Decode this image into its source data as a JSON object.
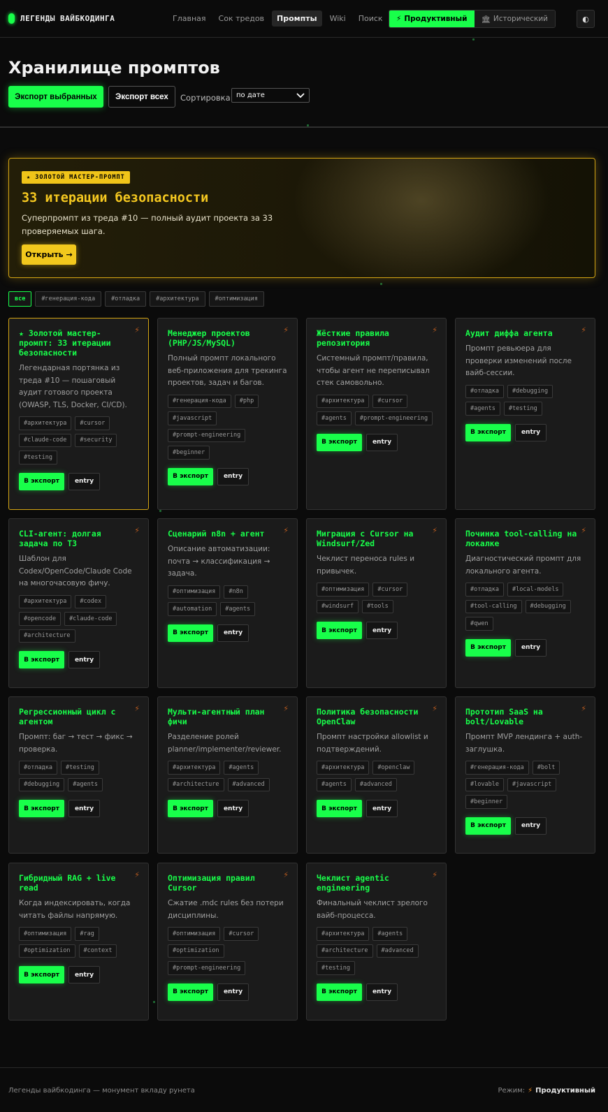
{
  "nav": {
    "logo": "ЛЕГЕНДЫ ВАЙБКОДИНГА",
    "items": [
      "Главная",
      "Сок тредов",
      "Промпты",
      "Wiki",
      "Поиск"
    ],
    "active_index": 2,
    "modes": [
      {
        "icon": "⚡",
        "label": "Продуктивный"
      },
      {
        "icon": "🏛",
        "label": "Исторический"
      }
    ],
    "theme_icon": "◐"
  },
  "header": {
    "title": "Хранилище промптов",
    "export_selected": "Экспорт выбранных",
    "export_all": "Экспорт всех",
    "sort_label": "Сортировка:",
    "sort_value": "по дате"
  },
  "hero": {
    "badge": "★ ЗОЛОТОЙ МАСТЕР-ПРОМПТ",
    "title": "33 итерации безопасности",
    "desc": "Суперпромпт из треда #10 — полный аудит проекта за 33 проверяемых шага.",
    "button": "Открыть →"
  },
  "filters": [
    "все",
    "#генерация-кода",
    "#отладка",
    "#архитектура",
    "#оптимизация"
  ],
  "card_buttons": {
    "export": "В экспорт",
    "entry": "entry"
  },
  "cards": [
    {
      "title": "★ Золотой мастер-промпт: 33 итерации безопасности",
      "desc": "Легендарная портянка из треда #10 — пошаговый аудит готового проекта (OWASP, TLS, Docker, CI/CD).",
      "tags": [
        "#архитектура",
        "#cursor",
        "#claude-code",
        "#security",
        "#testing"
      ],
      "gold": true
    },
    {
      "title": "Менеджер проектов (PHP/JS/MySQL)",
      "desc": "Полный промпт локального веб-приложения для трекинга проектов, задач и багов.",
      "tags": [
        "#генерация-кода",
        "#php",
        "#javascript",
        "#prompt-engineering",
        "#beginner"
      ]
    },
    {
      "title": "Жёсткие правила репозитория",
      "desc": "Системный промпт/правила, чтобы агент не переписывал стек самовольно.",
      "tags": [
        "#архитектура",
        "#cursor",
        "#agents",
        "#prompt-engineering"
      ]
    },
    {
      "title": "Аудит диффа агента",
      "desc": "Промпт ревьюера для проверки изменений после вайб-сессии.",
      "tags": [
        "#отладка",
        "#debugging",
        "#agents",
        "#testing"
      ]
    },
    {
      "title": "CLI-агент: долгая задача по ТЗ",
      "desc": "Шаблон для Codex/OpenCode/Claude Code на многочасовую фичу.",
      "tags": [
        "#архитектура",
        "#codex",
        "#opencode",
        "#claude-code",
        "#architecture"
      ]
    },
    {
      "title": "Сценарий n8n + агент",
      "desc": "Описание автоматизации: почта → классификация → задача.",
      "tags": [
        "#оптимизация",
        "#n8n",
        "#automation",
        "#agents"
      ]
    },
    {
      "title": "Миграция с Cursor на Windsurf/Zed",
      "desc": "Чеклист переноса rules и привычек.",
      "tags": [
        "#оптимизация",
        "#cursor",
        "#windsurf",
        "#tools"
      ]
    },
    {
      "title": "Починка tool-calling на локалке",
      "desc": "Диагностический промпт для локального агента.",
      "tags": [
        "#отладка",
        "#local-models",
        "#tool-calling",
        "#debugging",
        "#qwen"
      ]
    },
    {
      "title": "Регрессионный цикл с агентом",
      "desc": "Промпт: баг → тест → фикс → проверка.",
      "tags": [
        "#отладка",
        "#testing",
        "#debugging",
        "#agents"
      ]
    },
    {
      "title": "Мульти-агентный план фичи",
      "desc": "Разделение ролей planner/implementer/reviewer.",
      "tags": [
        "#архитектура",
        "#agents",
        "#architecture",
        "#advanced"
      ]
    },
    {
      "title": "Политика безопасности OpenClaw",
      "desc": "Промпт настройки allowlist и подтверждений.",
      "tags": [
        "#архитектура",
        "#openclaw",
        "#agents",
        "#advanced"
      ]
    },
    {
      "title": "Прототип SaaS на bolt/Lovable",
      "desc": "Промпт MVP лендинга + auth-заглушка.",
      "tags": [
        "#генерация-кода",
        "#bolt",
        "#lovable",
        "#javascript",
        "#beginner"
      ]
    },
    {
      "title": "Гибридный RAG + live read",
      "desc": "Когда индексировать, когда читать файлы напрямую.",
      "tags": [
        "#оптимизация",
        "#rag",
        "#optimization",
        "#context"
      ]
    },
    {
      "title": "Оптимизация правил Cursor",
      "desc": "Сжатие .mdc rules без потери дисциплины.",
      "tags": [
        "#оптимизация",
        "#cursor",
        "#optimization",
        "#prompt-engineering"
      ]
    },
    {
      "title": "Чеклист agentic engineering",
      "desc": "Финальный чеклист зрелого вайб-процесса.",
      "tags": [
        "#архитектура",
        "#agents",
        "#architecture",
        "#advanced",
        "#testing"
      ]
    }
  ],
  "footer": {
    "left": "Легенды вайбкодинга — монумент вкладу рунета",
    "mode_label": "Режим:",
    "mode_icon": "⚡",
    "mode_value": "Продуктивный"
  }
}
